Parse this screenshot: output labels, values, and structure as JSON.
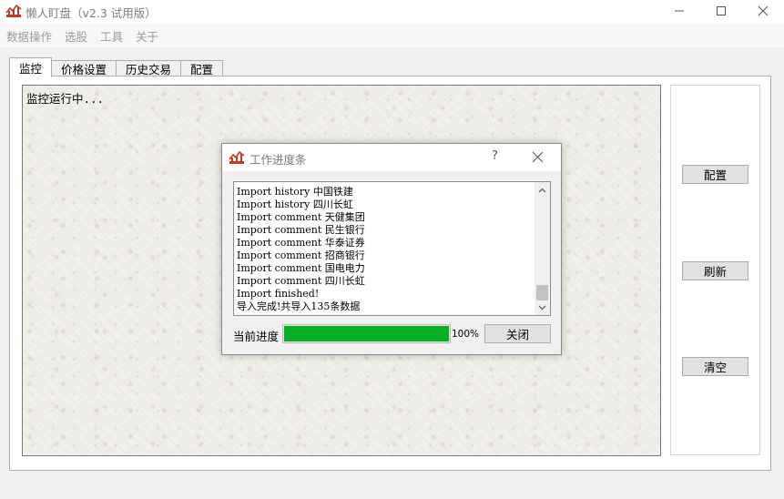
{
  "window": {
    "title": "懒人盯盘（v2.3 试用版）",
    "controls": [
      "minimize-icon",
      "maximize-icon",
      "close-icon"
    ]
  },
  "menu": [
    "数据操作",
    "选股",
    "工具",
    "关于"
  ],
  "tabs": [
    {
      "label": "监控",
      "active": true
    },
    {
      "label": "价格设置",
      "active": false
    },
    {
      "label": "历史交易",
      "active": false
    },
    {
      "label": "配置",
      "active": false
    }
  ],
  "monitor": {
    "status_text": "监控运行中..."
  },
  "side_buttons": {
    "config": "配置",
    "refresh": "刷新",
    "clear": "清空"
  },
  "dialog": {
    "title": "工作进度条",
    "help_label": "?",
    "log_lines": [
      "Import history 中国铁建",
      "Import history 四川长虹",
      "Import comment 天健集团",
      "Import comment 民生银行",
      "Import comment 华泰证券",
      "Import comment 招商银行",
      "Import comment 国电电力",
      "Import comment 四川长虹",
      "Import finished!",
      "导入完成!共导入135条数据"
    ],
    "progress_label": "当前进度",
    "progress_value": 1.0,
    "progress_text": "100%",
    "close_button": "关闭"
  },
  "colors": {
    "progress_fill": "#06b025",
    "logo_red": "#c0392b"
  }
}
